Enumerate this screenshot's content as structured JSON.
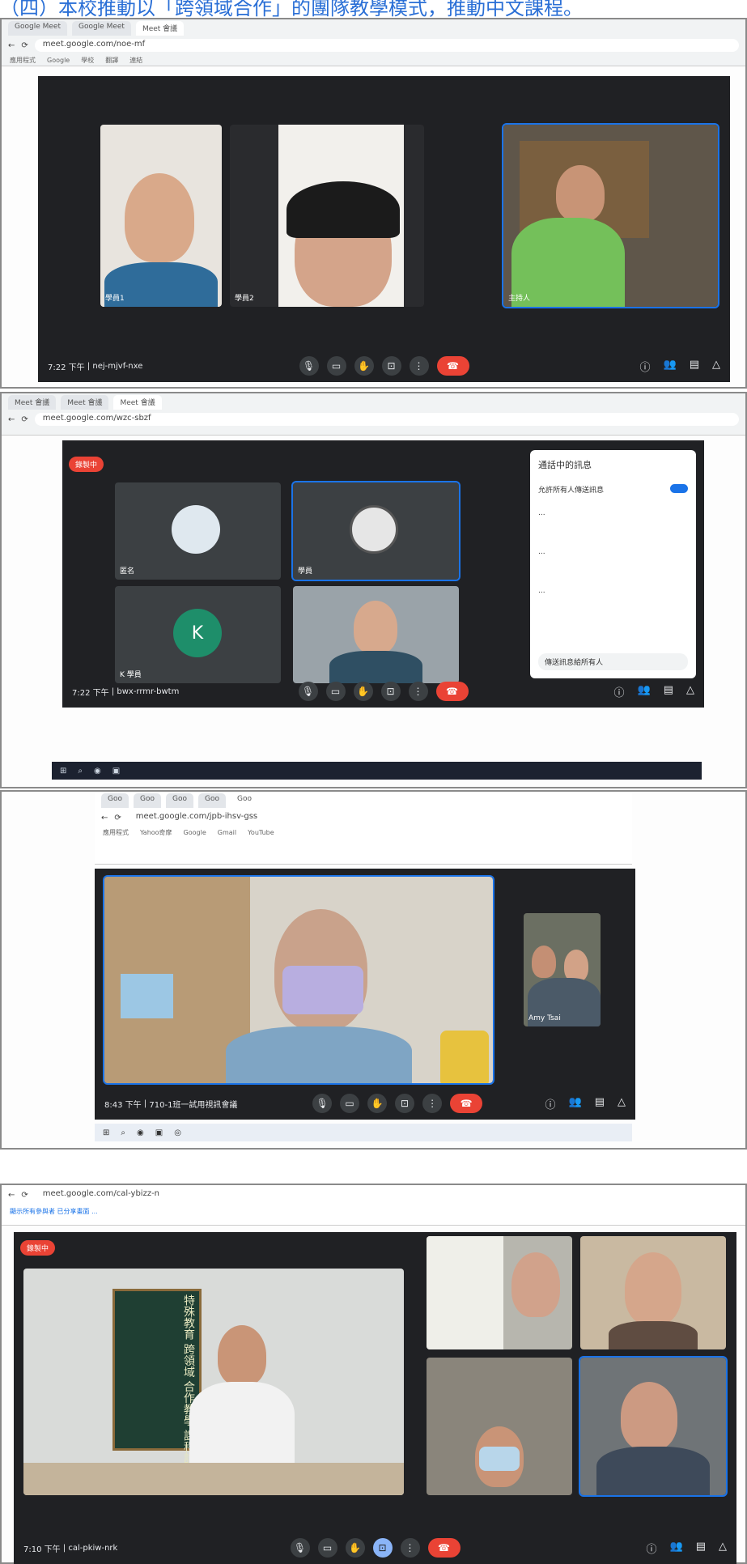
{
  "title": "（四）本校推動以「跨領域合作」的團隊教學模式，推動中文課程。",
  "panel1": {
    "tabs": [
      "Google Meet",
      "Google Meet",
      "Meet 會議"
    ],
    "url": "meet.google.com/noe-mf",
    "bookmarks": [
      "應用程式",
      "Google",
      "學校",
      "翻譯",
      "連結"
    ],
    "names": [
      "學員1",
      "學員2",
      "主持人"
    ],
    "time": "7:22 下午",
    "meeting": "nej-mjvf-nxe"
  },
  "panel2": {
    "tabs": [
      "Meet 會議",
      "Meet 會議",
      "Meet 會議"
    ],
    "url": "meet.google.com/wzc-sbzf",
    "rec": "錄製中",
    "names": [
      "匿名",
      "學員",
      "K 學員",
      ""
    ],
    "avatar_letter": "K",
    "time": "7:22 下午",
    "meeting": "bwx-rrmr-bwtm",
    "side_title": "通話中的訊息",
    "side_toggle": "允許所有人傳送訊息",
    "side_msgs": [
      "...",
      "...",
      "..."
    ],
    "side_input": "傳送訊息給所有人"
  },
  "panel3": {
    "tabs": [
      "Goo",
      "Goo",
      "Goo",
      "Goo",
      "Goo"
    ],
    "url": "meet.google.com/jpb-ihsv-gss",
    "bookmarks": [
      "應用程式",
      "Yahoo奇摩",
      "Google",
      "Gmail",
      "YouTube"
    ],
    "name_small": "Amy Tsai",
    "time": "8:43 下午",
    "meeting": "710-1班一試用視訊會議"
  },
  "panel4": {
    "url": "meet.google.com/cal-ybizz-n",
    "rec": "錄製中",
    "banner": "顯示所有參與者 已分享畫面 ...",
    "time": "7:10 下午",
    "meeting": "cal-pkiw-nrk",
    "board": "特殊教育 跨領域 合作教學 課程討論"
  }
}
